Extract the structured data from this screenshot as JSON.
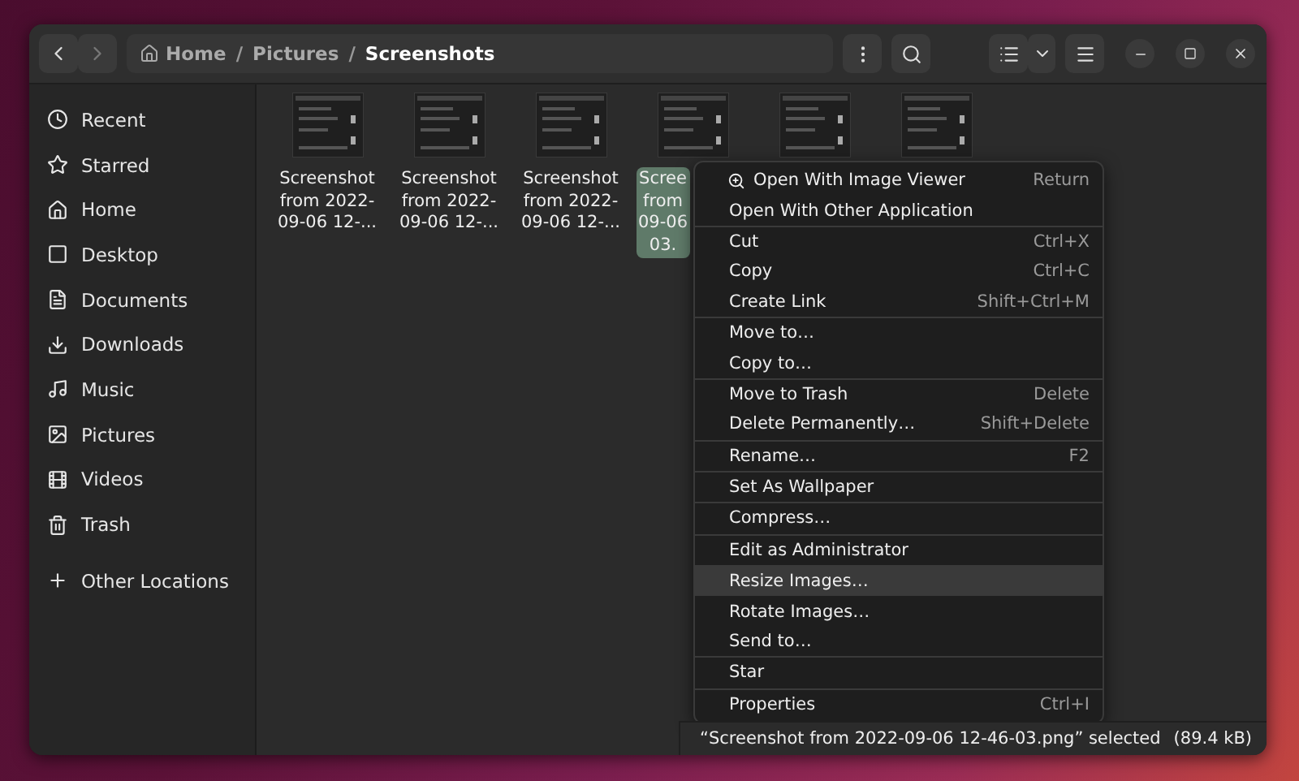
{
  "header": {
    "breadcrumb": [
      {
        "label": "Home",
        "current": false
      },
      {
        "label": "Pictures",
        "current": false
      },
      {
        "label": "Screenshots",
        "current": true
      }
    ],
    "separator": "/"
  },
  "sidebar": {
    "items": [
      {
        "label": "Recent"
      },
      {
        "label": "Starred"
      },
      {
        "label": "Home"
      },
      {
        "label": "Desktop"
      },
      {
        "label": "Documents"
      },
      {
        "label": "Downloads"
      },
      {
        "label": "Music"
      },
      {
        "label": "Pictures"
      },
      {
        "label": "Videos"
      },
      {
        "label": "Trash"
      }
    ],
    "other": {
      "label": "Other Locations"
    }
  },
  "files": [
    {
      "kind": "file",
      "lines": [
        "Screenshot",
        "from 2022-",
        "09-06 12-..."
      ],
      "selected": false
    },
    {
      "kind": "file",
      "lines": [
        "Screenshot",
        "from 2022-",
        "09-06 12-..."
      ],
      "selected": false
    },
    {
      "kind": "file",
      "lines": [
        "Screenshot",
        "from 2022-",
        "09-06 12-..."
      ],
      "selected": false
    },
    {
      "kind": "file",
      "lines": [
        "Scree",
        "from",
        "09-06",
        "03."
      ],
      "selected": true
    },
    {
      "kind": "thumbnail_only"
    },
    {
      "kind": "thumbnail_only"
    }
  ],
  "context_menu": {
    "sections": [
      [
        {
          "kind": "app",
          "label": "Open With Image Viewer",
          "shortcut": "Return",
          "highlighted": false
        },
        {
          "kind": "action",
          "label": "Open With Other Application",
          "highlighted": false
        }
      ],
      [
        {
          "kind": "action",
          "label": "Cut",
          "shortcut": "Ctrl+X",
          "highlighted": false
        },
        {
          "kind": "action",
          "label": "Copy",
          "shortcut": "Ctrl+C",
          "highlighted": false
        },
        {
          "kind": "action",
          "label": "Create Link",
          "shortcut": "Shift+Ctrl+M",
          "highlighted": false
        }
      ],
      [
        {
          "kind": "action",
          "label": "Move to…",
          "highlighted": false
        },
        {
          "kind": "action",
          "label": "Copy to…",
          "highlighted": false
        }
      ],
      [
        {
          "kind": "action",
          "label": "Move to Trash",
          "shortcut": "Delete",
          "highlighted": false
        },
        {
          "kind": "action",
          "label": "Delete Permanently…",
          "shortcut": "Shift+Delete",
          "highlighted": false
        }
      ],
      [
        {
          "kind": "action",
          "label": "Rename…",
          "shortcut": "F2",
          "highlighted": false
        }
      ],
      [
        {
          "kind": "action",
          "label": "Set As Wallpaper",
          "highlighted": false
        }
      ],
      [
        {
          "kind": "action",
          "label": "Compress…",
          "highlighted": false
        }
      ],
      [
        {
          "kind": "action",
          "label": "Edit as Administrator",
          "highlighted": false
        }
      ],
      [
        {
          "kind": "action",
          "label": "Resize Images…",
          "highlighted": true
        },
        {
          "kind": "action",
          "label": "Rotate Images…",
          "highlighted": false
        },
        {
          "kind": "action",
          "label": "Send to…",
          "highlighted": false
        }
      ],
      [
        {
          "kind": "action",
          "label": "Star",
          "highlighted": false
        }
      ],
      [
        {
          "kind": "action",
          "label": "Properties",
          "shortcut": "Ctrl+I",
          "highlighted": false
        }
      ]
    ]
  },
  "status_bar": {
    "text": "“Screenshot from 2022-09-06 12-46-03.png” selected",
    "size": "(89.4 kB)"
  }
}
